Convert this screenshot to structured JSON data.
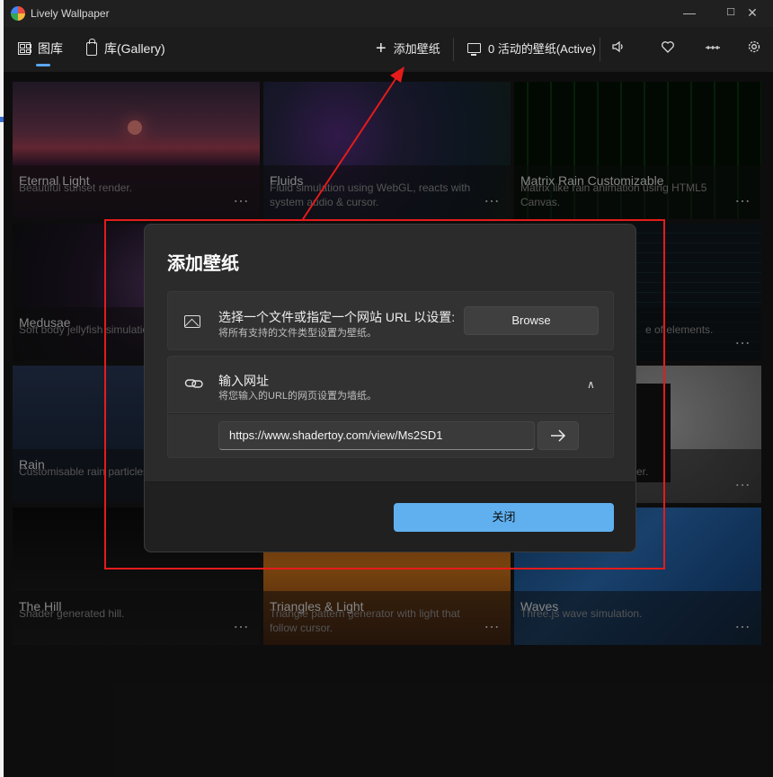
{
  "window": {
    "title": "Lively Wallpaper"
  },
  "window_controls": {
    "minimize": "—",
    "maximize": "☐",
    "close": "✕"
  },
  "nav": {
    "gallery": "图库",
    "library": "库(Gallery)",
    "add_wallpaper": "添加壁纸",
    "active_wallpapers": "0 活动的壁纸(Active)"
  },
  "tiles": [
    {
      "name": "Eternal Light",
      "desc": "Beautiful sunset render.",
      "more": "…"
    },
    {
      "name": "Fluids",
      "desc": "Fluid simulation using WebGL, reacts with system audio & cursor.",
      "more": "…"
    },
    {
      "name": "Matrix Rain Customizable",
      "desc": "Matrix like rain animation using HTML5 Canvas.",
      "more": "…"
    },
    {
      "name": "Medusae",
      "desc": "Soft body jellyfish simulation",
      "more": "…"
    },
    {
      "name": "",
      "desc": "e of elements.",
      "more": "…"
    },
    {
      "name": "Rain",
      "desc": "Customisable rain particles",
      "more": "…"
    },
    {
      "name": "",
      "desc": "er.",
      "more": "…"
    },
    {
      "name": "The Hill",
      "desc": "Shader generated hill.",
      "more": "…"
    },
    {
      "name": "Triangles & Light",
      "desc": "Triangle pattern generator with light that follow cursor.",
      "more": "…"
    },
    {
      "name": "Waves",
      "desc": "Three.js wave simulation.",
      "more": "…"
    }
  ],
  "dialog": {
    "title": "添加壁纸",
    "file_title": "选择一个文件或指定一个网站 URL 以设置:",
    "file_sub": "将所有支持的文件类型设置为壁纸。",
    "browse": "Browse",
    "url_title": "输入网址",
    "url_sub": "将您输入的URL的网页设置为墙纸。",
    "url_value": "https://www.shadertoy.com/view/Ms2SD1",
    "close": "关闭"
  },
  "colors": {
    "accent": "#60b0f0",
    "annotation": "#e51b1b"
  }
}
